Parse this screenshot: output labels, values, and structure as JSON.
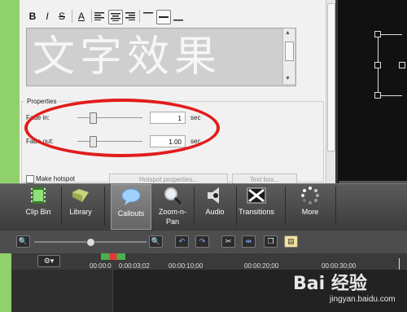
{
  "formatting": {
    "bold": "B",
    "italic": "I",
    "strike": "S",
    "text_color": "A"
  },
  "text_box": {
    "content": "文字效果"
  },
  "properties": {
    "title": "Properties",
    "fade_in_label": "Fade in:",
    "fade_in_value": "1",
    "fade_out_label": "Fade out:",
    "fade_out_value": "1.00",
    "unit": "sec",
    "make_hotspot_label": "Make hotspot",
    "hotspot_properties_label": "Hotspot properties...",
    "text_box_label": "Text box..."
  },
  "toolbar": {
    "items": [
      {
        "label": "Clip Bin",
        "icon": "film-icon"
      },
      {
        "label": "Library",
        "icon": "folder-icon"
      },
      {
        "label": "Callouts",
        "icon": "speech-bubble-icon",
        "active": true
      },
      {
        "label": "Zoom-n-\nPan",
        "icon": "magnifier-icon"
      },
      {
        "label": "Audio",
        "icon": "speaker-icon"
      },
      {
        "label": "Transitions",
        "icon": "transitions-icon"
      },
      {
        "label": "More",
        "icon": "more-icon"
      }
    ]
  },
  "timeline": {
    "ticks": [
      "00:00:0",
      "0:00:03;02",
      "00:00:10;00",
      "00:00:20;00",
      "00:00:30;00"
    ]
  },
  "watermark": {
    "title": "Bai 经验",
    "url": "jingyan.baidu.com"
  },
  "colors": {
    "accent_red": "#e21c1c",
    "desktop_green": "#8fd16b",
    "toolbar_dark": "#3b3b3b"
  }
}
